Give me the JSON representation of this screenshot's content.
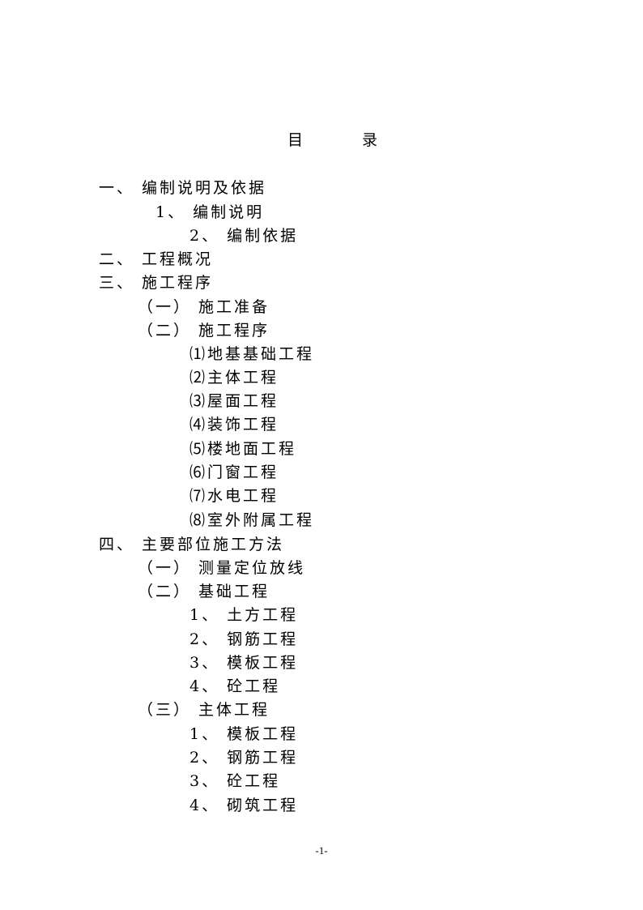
{
  "title": {
    "char1": "目",
    "char2": "录"
  },
  "toc": [
    {
      "text": "一、 编制说明及依据",
      "level": 1
    },
    {
      "text": "1、 编制说明",
      "level": 2
    },
    {
      "text": "2、 编制依据",
      "level": 2
    },
    {
      "text": "二、 工程概况",
      "level": 1
    },
    {
      "text": "三、 施工程序",
      "level": 1
    },
    {
      "text": "（一） 施工准备",
      "level": 2
    },
    {
      "text": "（二） 施工程序",
      "level": 2
    },
    {
      "text": "⑴地基基础工程",
      "level": 3
    },
    {
      "text": "⑵主体工程",
      "level": 3
    },
    {
      "text": "⑶屋面工程",
      "level": 3
    },
    {
      "text": "⑷装饰工程",
      "level": 3
    },
    {
      "text": "⑸楼地面工程",
      "level": 3
    },
    {
      "text": "⑹门窗工程",
      "level": 3
    },
    {
      "text": "⑺水电工程",
      "level": 3
    },
    {
      "text": "⑻室外附属工程",
      "level": 3
    },
    {
      "text": "四、 主要部位施工方法",
      "level": 1
    },
    {
      "text": "（一） 测量定位放线",
      "level": 2
    },
    {
      "text": "（二） 基础工程",
      "level": 2
    },
    {
      "text": "1、 土方工程",
      "level": 3
    },
    {
      "text": "2、 钢筋工程",
      "level": 3
    },
    {
      "text": "3、 模板工程",
      "level": 3
    },
    {
      "text": "4、 砼工程",
      "level": 3
    },
    {
      "text": "（三） 主体工程",
      "level": 2
    },
    {
      "text": "1、 模板工程",
      "level": 3
    },
    {
      "text": "2、 钢筋工程",
      "level": 3
    },
    {
      "text": "3、 砼工程",
      "level": 3
    },
    {
      "text": "4、 砌筑工程",
      "level": 3
    }
  ],
  "footer": {
    "page_number": "-1-"
  }
}
